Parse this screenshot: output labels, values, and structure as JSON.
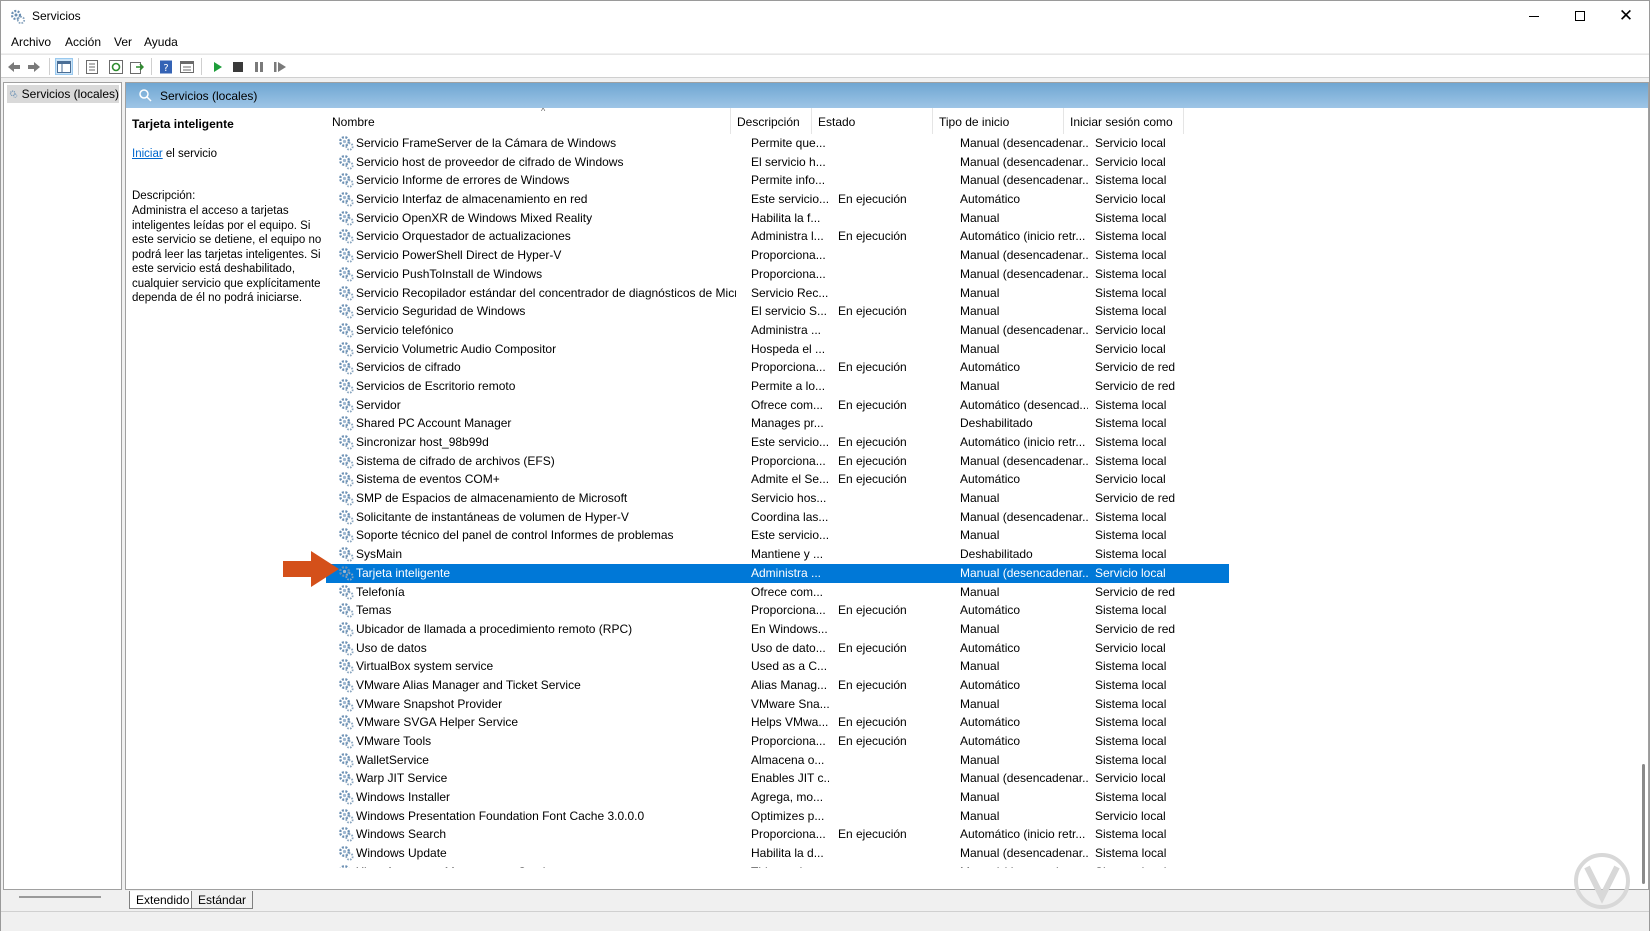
{
  "window": {
    "title": "Servicios"
  },
  "menu": [
    "Archivo",
    "Acción",
    "Ver",
    "Ayuda"
  ],
  "toolbar": {
    "icons": [
      "back-icon",
      "forward-icon",
      "show-tree-icon",
      "properties-icon",
      "refresh-icon",
      "export-icon",
      "help-icon",
      "detail-view-icon",
      "start-icon",
      "stop-icon",
      "pause-icon",
      "resume-icon"
    ]
  },
  "tree": {
    "root_label": "Servicios (locales)"
  },
  "panel": {
    "header_label": "Servicios (locales)"
  },
  "description": {
    "title": "Tarjeta inteligente",
    "action_link": "Iniciar",
    "action_rest": " el servicio",
    "label": "Descripción:",
    "text": "Administra el acceso a tarjetas inteligentes leídas por el equipo. Si este servicio se detiene, el equipo no podrá leer las tarjetas inteligentes. Si este servicio está deshabilitado, cualquier servicio que explícitamente dependa de él no podrá iniciarse."
  },
  "columns": {
    "name": "Nombre",
    "desc": "Descripción",
    "state": "Estado",
    "start": "Tipo de inicio",
    "logon": "Iniciar sesión como"
  },
  "services": [
    {
      "name": "Servicio FrameServer de la Cámara de Windows",
      "desc": "Permite que...",
      "state": "",
      "start": "Manual (desencadenar...",
      "logon": "Servicio local"
    },
    {
      "name": "Servicio host de proveedor de cifrado de Windows",
      "desc": "El servicio h...",
      "state": "",
      "start": "Manual (desencadenar...",
      "logon": "Servicio local"
    },
    {
      "name": "Servicio Informe de errores de Windows",
      "desc": "Permite info...",
      "state": "",
      "start": "Manual (desencadenar...",
      "logon": "Sistema local"
    },
    {
      "name": "Servicio Interfaz de almacenamiento en red",
      "desc": "Este servicio...",
      "state": "En ejecución",
      "start": "Automático",
      "logon": "Servicio local"
    },
    {
      "name": "Servicio OpenXR de Windows Mixed Reality",
      "desc": "Habilita la f...",
      "state": "",
      "start": "Manual",
      "logon": "Sistema local"
    },
    {
      "name": "Servicio Orquestador de actualizaciones",
      "desc": "Administra l...",
      "state": "En ejecución",
      "start": "Automático (inicio retr...",
      "logon": "Sistema local"
    },
    {
      "name": "Servicio PowerShell Direct de Hyper-V",
      "desc": "Proporciona...",
      "state": "",
      "start": "Manual (desencadenar...",
      "logon": "Sistema local"
    },
    {
      "name": "Servicio PushToInstall de Windows",
      "desc": "Proporciona...",
      "state": "",
      "start": "Manual (desencadenar...",
      "logon": "Sistema local"
    },
    {
      "name": "Servicio Recopilador estándar del concentrador de diagnósticos de Microsof...",
      "desc": "Servicio Rec...",
      "state": "",
      "start": "Manual",
      "logon": "Sistema local"
    },
    {
      "name": "Servicio Seguridad de Windows",
      "desc": "El servicio S...",
      "state": "En ejecución",
      "start": "Manual",
      "logon": "Sistema local"
    },
    {
      "name": "Servicio telefónico",
      "desc": "Administra ...",
      "state": "",
      "start": "Manual (desencadenar...",
      "logon": "Servicio local"
    },
    {
      "name": "Servicio Volumetric Audio Compositor",
      "desc": "Hospeda el ...",
      "state": "",
      "start": "Manual",
      "logon": "Servicio local"
    },
    {
      "name": "Servicios de cifrado",
      "desc": "Proporciona...",
      "state": "En ejecución",
      "start": "Automático",
      "logon": "Servicio de red"
    },
    {
      "name": "Servicios de Escritorio remoto",
      "desc": "Permite a lo...",
      "state": "",
      "start": "Manual",
      "logon": "Servicio de red"
    },
    {
      "name": "Servidor",
      "desc": "Ofrece com...",
      "state": "En ejecución",
      "start": "Automático (desencad...",
      "logon": "Sistema local"
    },
    {
      "name": "Shared PC Account Manager",
      "desc": "Manages pr...",
      "state": "",
      "start": "Deshabilitado",
      "logon": "Sistema local"
    },
    {
      "name": "Sincronizar host_98b99d",
      "desc": "Este servicio...",
      "state": "En ejecución",
      "start": "Automático (inicio retr...",
      "logon": "Sistema local"
    },
    {
      "name": "Sistema de cifrado de archivos (EFS)",
      "desc": "Proporciona...",
      "state": "En ejecución",
      "start": "Manual (desencadenar...",
      "logon": "Sistema local"
    },
    {
      "name": "Sistema de eventos COM+",
      "desc": "Admite el Se...",
      "state": "En ejecución",
      "start": "Automático",
      "logon": "Servicio local"
    },
    {
      "name": "SMP de Espacios de almacenamiento de Microsoft",
      "desc": "Servicio hos...",
      "state": "",
      "start": "Manual",
      "logon": "Servicio de red"
    },
    {
      "name": "Solicitante de instantáneas de volumen de Hyper-V",
      "desc": "Coordina las...",
      "state": "",
      "start": "Manual (desencadenar...",
      "logon": "Sistema local"
    },
    {
      "name": "Soporte técnico del panel de control Informes de problemas",
      "desc": "Este servicio...",
      "state": "",
      "start": "Manual",
      "logon": "Sistema local"
    },
    {
      "name": "SysMain",
      "desc": "Mantiene y ...",
      "state": "",
      "start": "Deshabilitado",
      "logon": "Sistema local"
    },
    {
      "name": "Tarjeta inteligente",
      "desc": "Administra ...",
      "state": "",
      "start": "Manual (desencadenar...",
      "logon": "Servicio local",
      "selected": true
    },
    {
      "name": "Telefonía",
      "desc": "Ofrece com...",
      "state": "",
      "start": "Manual",
      "logon": "Servicio de red"
    },
    {
      "name": "Temas",
      "desc": "Proporciona...",
      "state": "En ejecución",
      "start": "Automático",
      "logon": "Sistema local"
    },
    {
      "name": "Ubicador de llamada a procedimiento remoto (RPC)",
      "desc": "En Windows...",
      "state": "",
      "start": "Manual",
      "logon": "Servicio de red"
    },
    {
      "name": "Uso de datos",
      "desc": "Uso de dato...",
      "state": "En ejecución",
      "start": "Automático",
      "logon": "Servicio local"
    },
    {
      "name": "VirtualBox system service",
      "desc": "Used as a C...",
      "state": "",
      "start": "Manual",
      "logon": "Sistema local"
    },
    {
      "name": "VMware Alias Manager and Ticket Service",
      "desc": "Alias Manag...",
      "state": "En ejecución",
      "start": "Automático",
      "logon": "Sistema local"
    },
    {
      "name": "VMware Snapshot Provider",
      "desc": "VMware Sna...",
      "state": "",
      "start": "Manual",
      "logon": "Sistema local"
    },
    {
      "name": "VMware SVGA Helper Service",
      "desc": "Helps VMwa...",
      "state": "En ejecución",
      "start": "Automático",
      "logon": "Sistema local"
    },
    {
      "name": "VMware Tools",
      "desc": "Proporciona...",
      "state": "En ejecución",
      "start": "Automático",
      "logon": "Sistema local"
    },
    {
      "name": "WalletService",
      "desc": "Almacena o...",
      "state": "",
      "start": "Manual",
      "logon": "Sistema local"
    },
    {
      "name": "Warp JIT Service",
      "desc": "Enables JIT c...",
      "state": "",
      "start": "Manual (desencadenar...",
      "logon": "Servicio local"
    },
    {
      "name": "Windows Installer",
      "desc": "Agrega, mo...",
      "state": "",
      "start": "Manual",
      "logon": "Sistema local"
    },
    {
      "name": "Windows Presentation Foundation Font Cache 3.0.0.0",
      "desc": "Optimizes p...",
      "state": "",
      "start": "Manual",
      "logon": "Servicio local"
    },
    {
      "name": "Windows Search",
      "desc": "Proporciona...",
      "state": "En ejecución",
      "start": "Automático (inicio retr...",
      "logon": "Sistema local"
    },
    {
      "name": "Windows Update",
      "desc": "Habilita la d...",
      "state": "",
      "start": "Manual (desencadenar...",
      "logon": "Sistema local"
    },
    {
      "name": "Xbox Accessory Management Service",
      "desc": "This service ...",
      "state": "",
      "start": "Manual (desencadenar...",
      "logon": "Sistema local"
    }
  ],
  "tabs": [
    "Extendido",
    "Estándar"
  ],
  "colors": {
    "selection": "#0078d7",
    "header_gradient_top": "#6fa6d2",
    "header_gradient_bottom": "#9ec5e6",
    "arrow": "#d4501a",
    "link": "#0066cc"
  }
}
